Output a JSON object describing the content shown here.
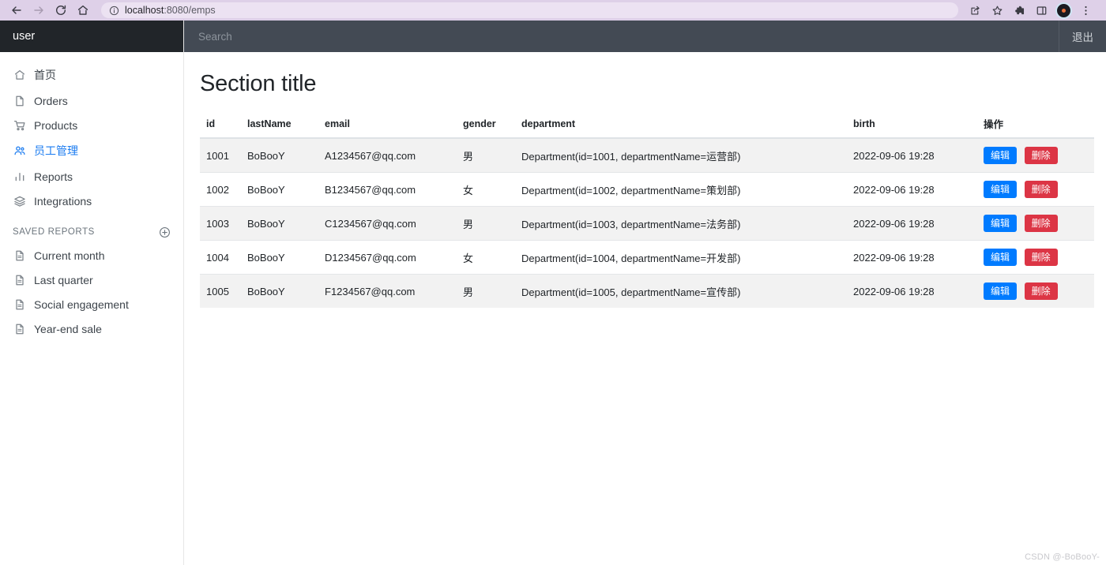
{
  "browser": {
    "back_icon": "arrow-left-icon",
    "forward_icon": "arrow-right-icon",
    "reload_icon": "reload-icon",
    "home_icon": "home-icon",
    "site_info_icon": "info-circle-icon",
    "url_host": "localhost",
    "url_path": ":8080/emps",
    "share_icon": "share-icon",
    "bookmark_icon": "star-icon",
    "extensions_icon": "puzzle-icon",
    "sidepanel_icon": "side-panel-icon",
    "profile_icon": "profile-avatar-icon",
    "menu_icon": "three-dot-menu-icon"
  },
  "sidebar": {
    "brand": "user",
    "items": [
      {
        "label": "首页",
        "icon": "home-icon",
        "active": false
      },
      {
        "label": "Orders",
        "icon": "file-icon",
        "active": false
      },
      {
        "label": "Products",
        "icon": "cart-icon",
        "active": false
      },
      {
        "label": "员工管理",
        "icon": "people-icon",
        "active": true
      },
      {
        "label": "Reports",
        "icon": "bar-chart-icon",
        "active": false
      },
      {
        "label": "Integrations",
        "icon": "layers-icon",
        "active": false
      }
    ],
    "saved_reports_label": "SAVED REPORTS",
    "add_report_icon": "plus-circle-icon",
    "saved_reports": [
      {
        "label": "Current month",
        "icon": "file-icon"
      },
      {
        "label": "Last quarter",
        "icon": "file-icon"
      },
      {
        "label": "Social engagement",
        "icon": "file-icon"
      },
      {
        "label": "Year-end sale",
        "icon": "file-icon"
      }
    ]
  },
  "topbar": {
    "search_placeholder": "Search",
    "search_value": "",
    "logout_label": "退出"
  },
  "main": {
    "title": "Section title",
    "columns": [
      "id",
      "lastName",
      "email",
      "gender",
      "department",
      "birth",
      "操作"
    ],
    "rows": [
      {
        "id": "1001",
        "lastName": "BoBooY",
        "email": "A1234567@qq.com",
        "gender": "男",
        "department": "Department(id=1001, departmentName=运营部)",
        "birth": "2022-09-06 19:28"
      },
      {
        "id": "1002",
        "lastName": "BoBooY",
        "email": "B1234567@qq.com",
        "gender": "女",
        "department": "Department(id=1002, departmentName=策划部)",
        "birth": "2022-09-06 19:28"
      },
      {
        "id": "1003",
        "lastName": "BoBooY",
        "email": "C1234567@qq.com",
        "gender": "男",
        "department": "Department(id=1003, departmentName=法务部)",
        "birth": "2022-09-06 19:28"
      },
      {
        "id": "1004",
        "lastName": "BoBooY",
        "email": "D1234567@qq.com",
        "gender": "女",
        "department": "Department(id=1004, departmentName=开发部)",
        "birth": "2022-09-06 19:28"
      },
      {
        "id": "1005",
        "lastName": "BoBooY",
        "email": "F1234567@qq.com",
        "gender": "男",
        "department": "Department(id=1005, departmentName=宣传部)",
        "birth": "2022-09-06 19:28"
      }
    ],
    "edit_label": "编辑",
    "delete_label": "删除"
  },
  "watermark": "CSDN @-BoBooY-",
  "colors": {
    "brand_bar": "#212529",
    "topbar": "#434a54",
    "browser_chrome": "#ded0e8",
    "accent_blue": "#007bff",
    "danger_red": "#dc3545",
    "row_stripe": "#f2f2f2"
  }
}
